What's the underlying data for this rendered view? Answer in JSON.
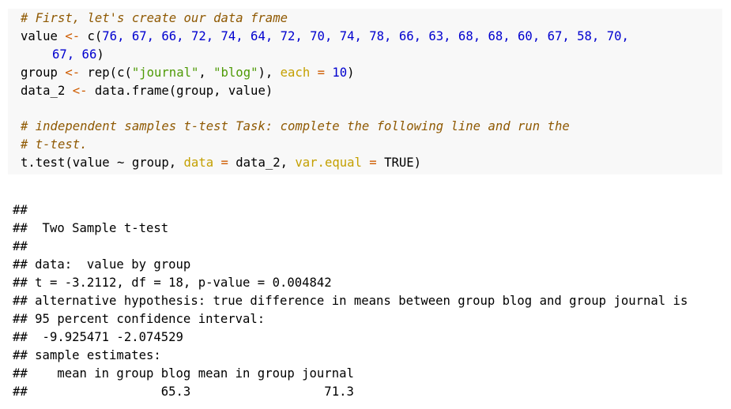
{
  "code": {
    "comment1": "# First, let's create our data frame",
    "value_var": "value",
    "assign": "<-",
    "c_open": "c(",
    "values_line1": "76, 67, 66, 72, 74, 64, 72, 70, 74, 78, 66, 63, 68, 68, 60, 67, 58, 70,",
    "values_line2": "67, 66",
    "close_paren": ")",
    "group_var": "group",
    "rep_open": "rep(c(",
    "str_journal": "\"journal\"",
    "comma": ", ",
    "str_blog": "\"blog\"",
    "rep_close": "), ",
    "arg_each": "each",
    "eq": " = ",
    "each_val": "10",
    "data2_var": "data_2",
    "dataframe_call": "data.frame(group, value)",
    "comment2": "# independent samples t-test Task: complete the following line and run the",
    "comment3": "# t-test.",
    "ttest_open": "t.test(value ~ group, ",
    "arg_data": "data",
    "data_val": "data_2, ",
    "arg_var_equal": "var.equal",
    "true_close": "TRUE)"
  },
  "output": {
    "lines": [
      "##",
      "##  Two Sample t-test",
      "##",
      "## data:  value by group",
      "## t = -3.2112, df = 18, p-value = 0.004842",
      "## alternative hypothesis: true difference in means between group blog and group journal is",
      "## 95 percent confidence interval:",
      "##  -9.925471 -2.074529",
      "## sample estimates:",
      "##    mean in group blog mean in group journal",
      "##                  65.3                  71.3"
    ]
  }
}
